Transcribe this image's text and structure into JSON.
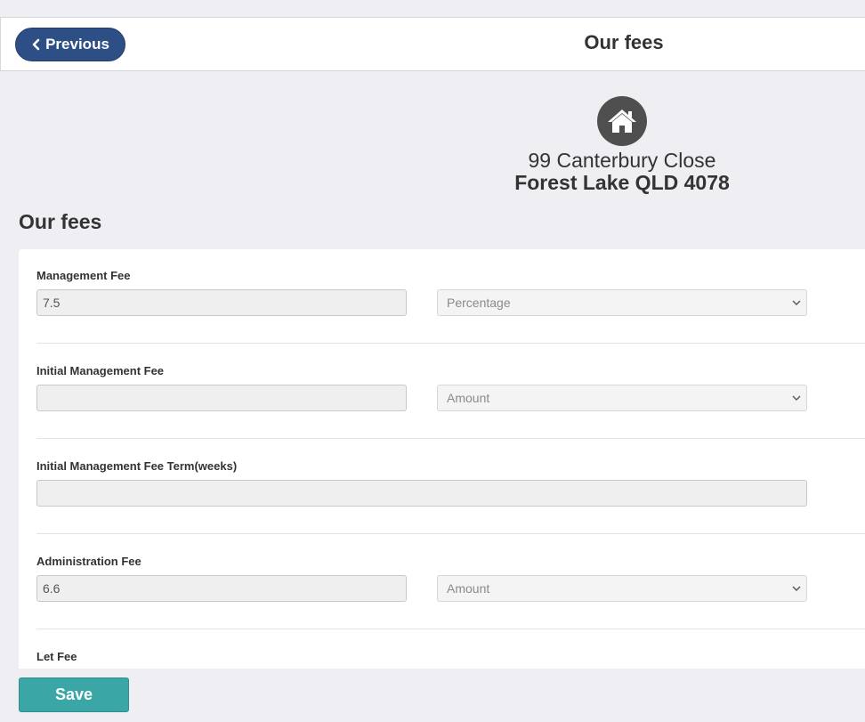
{
  "header": {
    "previous_label": "Previous",
    "title": "Our fees"
  },
  "property": {
    "icon": "house-icon",
    "address_line1": "99 Canterbury Close",
    "address_line2": "Forest Lake QLD 4078"
  },
  "section": {
    "title": "Our fees"
  },
  "fields": [
    {
      "label": "Management Fee",
      "value": "7.5",
      "type": "Percentage"
    },
    {
      "label": "Initial Management Fee",
      "value": "",
      "type": "Amount"
    },
    {
      "label": "Initial Management Fee Term(weeks)",
      "value": ""
    },
    {
      "label": "Administration Fee",
      "value": "6.6",
      "type": "Amount"
    },
    {
      "label": "Let Fee"
    }
  ],
  "footer": {
    "save_label": "Save"
  },
  "colors": {
    "previous_button": "#2e4f86",
    "save_button": "#3aa6a5",
    "icon_circle": "#4f4f4f",
    "background": "#efeff3"
  }
}
